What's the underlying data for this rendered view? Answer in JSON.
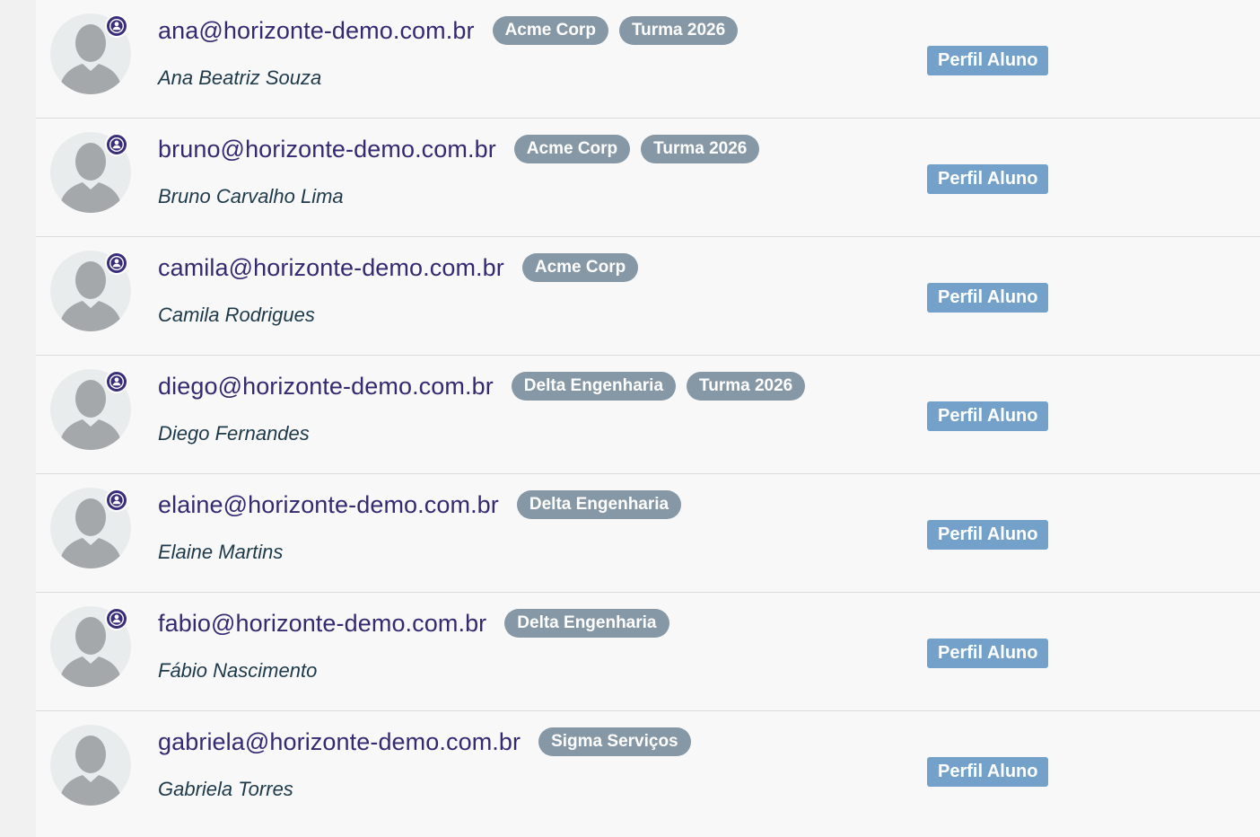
{
  "colors": {
    "email_text": "#352a72",
    "tag_background": "#8697a6",
    "profile_button_background": "#74a1c9",
    "name_text": "#1e3a4a",
    "row_background": "#f8f8f8"
  },
  "icons": {
    "avatar": "person-silhouette-icon",
    "status": "user-circle-icon"
  },
  "users": [
    {
      "email": "ana@horizonte-demo.com.br",
      "tags": [
        "Acme Corp",
        "Turma 2026"
      ],
      "name": "Ana Beatriz Souza",
      "profile_label": "Perfil Aluno",
      "has_status_icon": true
    },
    {
      "email": "bruno@horizonte-demo.com.br",
      "tags": [
        "Acme Corp",
        "Turma 2026"
      ],
      "name": "Bruno Carvalho Lima",
      "profile_label": "Perfil Aluno",
      "has_status_icon": true
    },
    {
      "email": "camila@horizonte-demo.com.br",
      "tags": [
        "Acme Corp"
      ],
      "name": "Camila Rodrigues",
      "profile_label": "Perfil Aluno",
      "has_status_icon": true
    },
    {
      "email": "diego@horizonte-demo.com.br",
      "tags": [
        "Delta Engenharia",
        "Turma 2026"
      ],
      "name": "Diego Fernandes",
      "profile_label": "Perfil Aluno",
      "has_status_icon": true
    },
    {
      "email": "elaine@horizonte-demo.com.br",
      "tags": [
        "Delta Engenharia"
      ],
      "name": "Elaine Martins",
      "profile_label": "Perfil Aluno",
      "has_status_icon": true
    },
    {
      "email": "fabio@horizonte-demo.com.br",
      "tags": [
        "Delta Engenharia"
      ],
      "name": "Fábio Nascimento",
      "profile_label": "Perfil Aluno",
      "has_status_icon": true
    },
    {
      "email": "gabriela@horizonte-demo.com.br",
      "tags": [
        "Sigma Serviços"
      ],
      "name": "Gabriela Torres",
      "profile_label": "Perfil Aluno",
      "has_status_icon": false
    }
  ]
}
